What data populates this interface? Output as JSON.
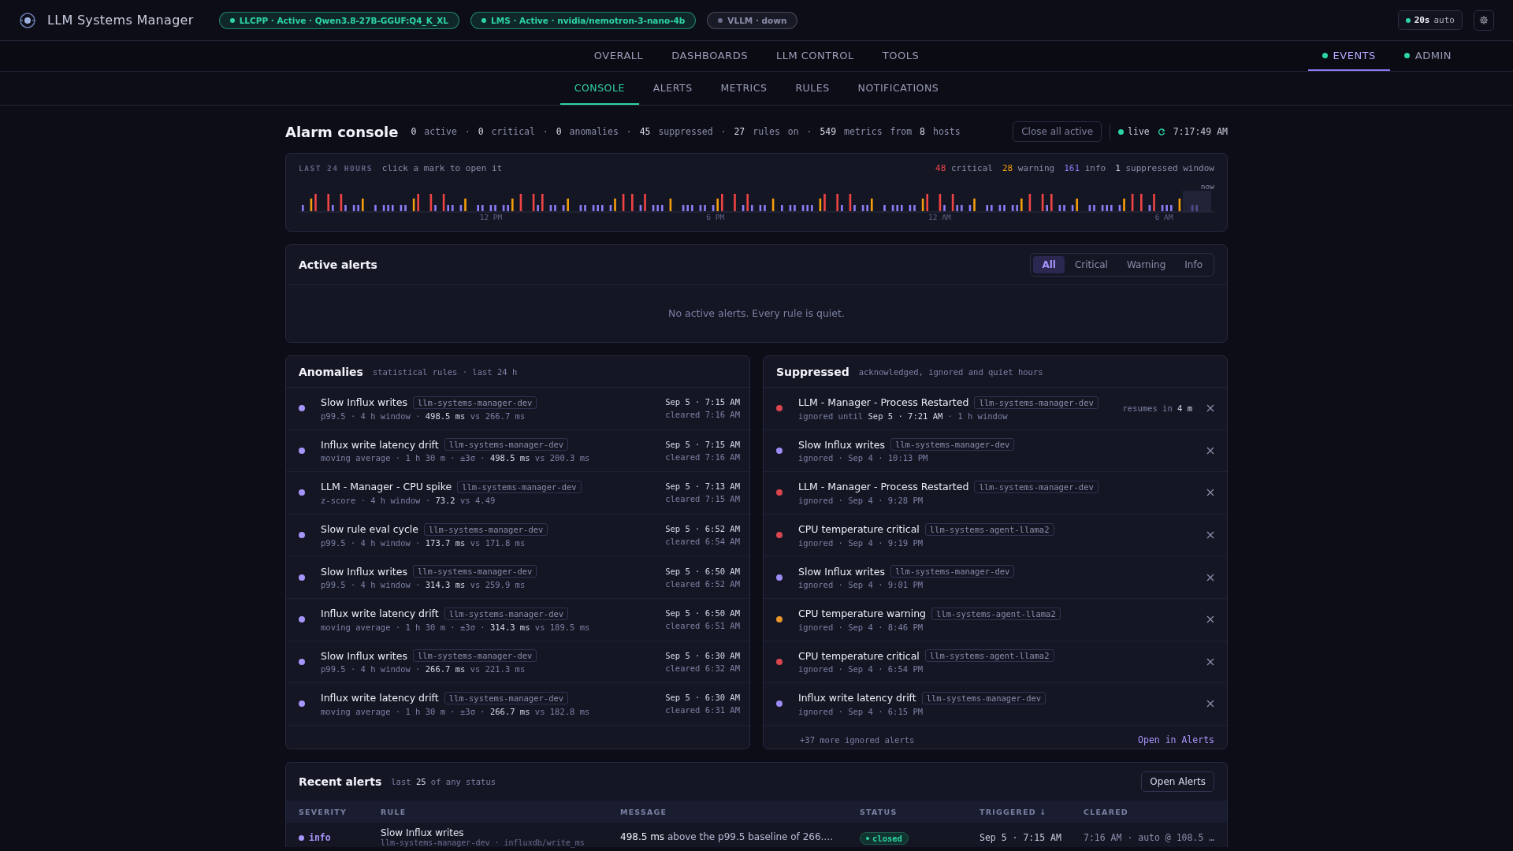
{
  "app": {
    "title": "LLM Systems Manager"
  },
  "status_pills": [
    {
      "label": "LLCPP · Active · Qwen3.8-27B-GGUF:Q4_K_XL",
      "color": "#2dd4a7"
    },
    {
      "label": "LMS · Active · nvidia/nemotron-3-nano-4b",
      "color": "#2dd4a7"
    },
    {
      "label": "VLLM · down",
      "color": "#6b6f8a"
    }
  ],
  "refresh": {
    "interval": "20s",
    "mode": "auto"
  },
  "main_nav": [
    {
      "label": "OVERALL",
      "selected": false
    },
    {
      "label": "DASHBOARDS",
      "selected": false
    },
    {
      "label": "LLM CONTROL",
      "selected": false
    },
    {
      "label": "TOOLS",
      "selected": false
    },
    {
      "label": "EVENTS",
      "selected": true,
      "color": "#2dd4a7"
    },
    {
      "label": "ADMIN",
      "selected": false,
      "color": "#2dd4a7"
    }
  ],
  "sub_nav": [
    {
      "label": "CONSOLE",
      "selected": true
    },
    {
      "label": "ALERTS",
      "selected": false
    },
    {
      "label": "METRICS",
      "selected": false
    },
    {
      "label": "RULES",
      "selected": false
    },
    {
      "label": "NOTIFICATIONS",
      "selected": false
    }
  ],
  "console": {
    "title": "Alarm console",
    "stats": "**0** active · **0** critical · **0** anomalies · **45** suppressed · **27** rules on · **549** metrics from **8** hosts",
    "close_button": "Close all active",
    "live": "live",
    "clock": "7:17:49 AM"
  },
  "timeline": {
    "label": "LAST 24 HOURS",
    "hint": "click a mark to open it",
    "legend": [
      {
        "count": "48",
        "label": "critical",
        "color": "#ef4444"
      },
      {
        "count": "28",
        "label": "warning",
        "color": "#f59e0b"
      },
      {
        "count": "161",
        "label": "info",
        "color": "#8b7cf6"
      },
      {
        "count": "1",
        "label": "suppressed window",
        "color": "#c8cbe0"
      }
    ],
    "axis": [
      "12 PM",
      "6 PM",
      "12 AM",
      "6 AM"
    ],
    "now": "now"
  },
  "active_alerts": {
    "title": "Active alerts",
    "filters": [
      {
        "label": "All",
        "selected": true
      },
      {
        "label": "Critical",
        "selected": false
      },
      {
        "label": "Warning",
        "selected": false
      },
      {
        "label": "Info",
        "selected": false
      }
    ],
    "empty": "No active alerts. Every rule is quiet."
  },
  "anomalies": {
    "title": "Anomalies",
    "subtitle": "statistical rules · last 24 h",
    "items": [
      {
        "name": "Slow Influx writes",
        "host": "llm-systems-manager-dev",
        "detail": "p99.5 · 4 h window · **498.5 ms** vs 266.7 ms",
        "time": "Sep 5 · 7:15 AM",
        "cleared": "cleared 7:16 AM",
        "color": "#a594f9"
      },
      {
        "name": "Influx write latency drift",
        "host": "llm-systems-manager-dev",
        "detail": "moving average · 1 h 30 m · ±3σ · **498.5 ms** vs 200.3 ms",
        "time": "Sep 5 · 7:15 AM",
        "cleared": "cleared 7:16 AM",
        "color": "#a594f9"
      },
      {
        "name": "LLM - Manager - CPU spike",
        "host": "llm-systems-manager-dev",
        "detail": "z-score · 4 h window · **73.2** vs 4.49",
        "time": "Sep 5 · 7:13 AM",
        "cleared": "cleared 7:15 AM",
        "color": "#a594f9"
      },
      {
        "name": "Slow rule eval cycle",
        "host": "llm-systems-manager-dev",
        "detail": "p99.5 · 4 h window · **173.7 ms** vs 171.8 ms",
        "time": "Sep 5 · 6:52 AM",
        "cleared": "cleared 6:54 AM",
        "color": "#a594f9"
      },
      {
        "name": "Slow Influx writes",
        "host": "llm-systems-manager-dev",
        "detail": "p99.5 · 4 h window · **314.3 ms** vs 259.9 ms",
        "time": "Sep 5 · 6:50 AM",
        "cleared": "cleared 6:52 AM",
        "color": "#a594f9"
      },
      {
        "name": "Influx write latency drift",
        "host": "llm-systems-manager-dev",
        "detail": "moving average · 1 h 30 m · ±3σ · **314.3 ms** vs 189.5 ms",
        "time": "Sep 5 · 6:50 AM",
        "cleared": "cleared 6:51 AM",
        "color": "#a594f9"
      },
      {
        "name": "Slow Influx writes",
        "host": "llm-systems-manager-dev",
        "detail": "p99.5 · 4 h window · **266.7 ms** vs 221.3 ms",
        "time": "Sep 5 · 6:30 AM",
        "cleared": "cleared 6:32 AM",
        "color": "#a594f9"
      },
      {
        "name": "Influx write latency drift",
        "host": "llm-systems-manager-dev",
        "detail": "moving average · 1 h 30 m · ±3σ · **266.7 ms** vs 182.8 ms",
        "time": "Sep 5 · 6:30 AM",
        "cleared": "cleared 6:31 AM",
        "color": "#a594f9"
      }
    ]
  },
  "suppressed": {
    "title": "Suppressed",
    "subtitle": "acknowledged, ignored and quiet hours",
    "items": [
      {
        "name": "LLM - Manager - Process Restarted",
        "host": "llm-systems-manager-dev",
        "detail": "ignored until **Sep 5 · 7:21 AM** · 1 h window",
        "resumes": "resumes in **4 m**",
        "color": "#d9464f"
      },
      {
        "name": "Slow Influx writes",
        "host": "llm-systems-manager-dev",
        "detail": "ignored · Sep 4 · 10:13 PM",
        "color": "#9b8cf5"
      },
      {
        "name": "LLM - Manager - Process Restarted",
        "host": "llm-systems-manager-dev",
        "detail": "ignored · Sep 4 · 9:28 PM",
        "color": "#d9464f"
      },
      {
        "name": "CPU temperature critical",
        "host": "llm-systems-agent-llama2",
        "detail": "ignored · Sep 4 · 9:19 PM",
        "color": "#d9464f"
      },
      {
        "name": "Slow Influx writes",
        "host": "llm-systems-manager-dev",
        "detail": "ignored · Sep 4 · 9:01 PM",
        "color": "#9b8cf5"
      },
      {
        "name": "CPU temperature warning",
        "host": "llm-systems-agent-llama2",
        "detail": "ignored · Sep 4 · 8:46 PM",
        "color": "#e8962a"
      },
      {
        "name": "CPU temperature critical",
        "host": "llm-systems-agent-llama2",
        "detail": "ignored · Sep 4 · 6:54 PM",
        "color": "#d9464f"
      },
      {
        "name": "Influx write latency drift",
        "host": "llm-systems-manager-dev",
        "detail": "ignored · Sep 4 · 6:15 PM",
        "color": "#9b8cf5"
      }
    ],
    "more": "+37 more ignored alerts",
    "link": "Open in Alerts"
  },
  "recent_alerts": {
    "title": "Recent alerts",
    "subtitle": "last **25** of any status",
    "button": "Open Alerts",
    "columns": [
      "SEVERITY",
      "RULE",
      "MESSAGE",
      "STATUS",
      "TRIGGERED ↓",
      "CLEARED"
    ],
    "rows": [
      {
        "severity": "info",
        "color": "#a594f9",
        "rule": "Slow Influx writes",
        "rule_detail": "llm-systems-manager-dev · influxdb/write_ms",
        "message": "**498.5 ms** above the p99.5 baseline of 266.…",
        "status": "closed",
        "triggered": "Sep 5 · 7:15 AM",
        "cleared": "7:16 AM · auto @ 108.5 …"
      }
    ]
  }
}
